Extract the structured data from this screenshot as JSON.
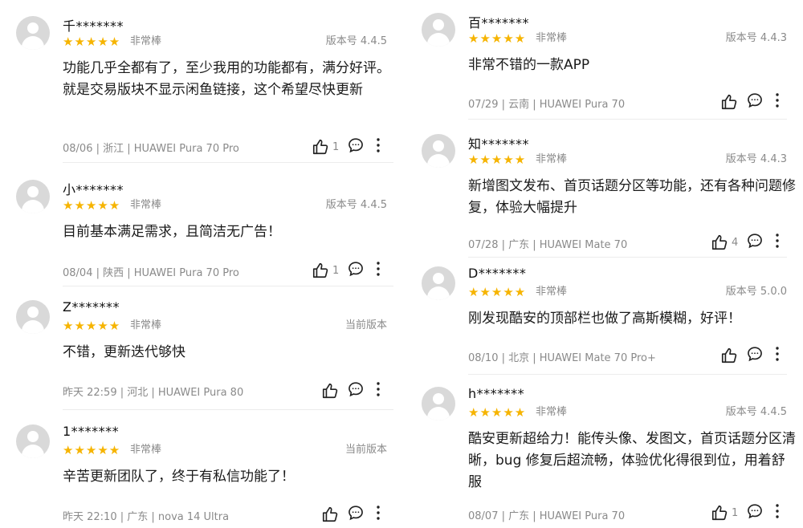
{
  "star_color": "#f6b400",
  "avatar_color": "#d9d9d9",
  "left_reviews": [
    {
      "name": "千*******",
      "stars": "★★★★★",
      "rating": "非常棒",
      "version": "版本号 4.4.5",
      "content": "功能几乎全都有了，至少我用的功能都有，满分好评。就是交易版块不显示闲鱼链接，这个希望尽快更新",
      "meta": "08/06 | 浙江 | HUAWEI Pura 70 Pro",
      "likes": "1"
    },
    {
      "name": "小*******",
      "stars": "★★★★★",
      "rating": "非常棒",
      "version": "版本号 4.4.5",
      "content": "目前基本满足需求，且简洁无广告！",
      "meta": "08/04 | 陕西 | HUAWEI Pura 70 Pro",
      "likes": "1"
    },
    {
      "name": "Z*******",
      "stars": "★★★★★",
      "rating": "非常棒",
      "version": "当前版本",
      "content": "不错，更新迭代够快",
      "meta": "昨天 22:59 | 河北 | HUAWEI Pura 80",
      "likes": ""
    },
    {
      "name": "1*******",
      "stars": "★★★★★",
      "rating": "非常棒",
      "version": "当前版本",
      "content": "辛苦更新团队了，终于有私信功能了！",
      "meta": "昨天 22:10 | 广东 | nova 14 Ultra",
      "likes": ""
    }
  ],
  "right_reviews": [
    {
      "name": "百*******",
      "stars": "★★★★★",
      "rating": "非常棒",
      "version": "版本号 4.4.3",
      "content": "非常不错的一款APP",
      "meta": "07/29 | 云南 | HUAWEI Pura 70",
      "likes": ""
    },
    {
      "name": "知*******",
      "stars": "★★★★★",
      "rating": "非常棒",
      "version": "版本号 4.4.3",
      "content": "新增图文发布、首页话题分区等功能，还有各种问题修复，体验大幅提升",
      "meta": "07/28 | 广东 | HUAWEI Mate 70",
      "likes": "4"
    },
    {
      "name": "D*******",
      "stars": "★★★★★",
      "rating": "非常棒",
      "version": "版本号 5.0.0",
      "content": "刚发现酷安的顶部栏也做了高斯模糊，好评！",
      "meta": "08/10 | 北京 | HUAWEI Mate 70 Pro+",
      "likes": ""
    },
    {
      "name": "h*******",
      "stars": "★★★★★",
      "rating": "非常棒",
      "version": "版本号 4.4.5",
      "content": "酷安更新超给力！能传头像、发图文，首页话题分区清晰，bug 修复后超流畅，体验优化得很到位，用着舒服",
      "meta": "08/07 | 广东 | HUAWEI Pura 70",
      "likes": "1"
    }
  ]
}
